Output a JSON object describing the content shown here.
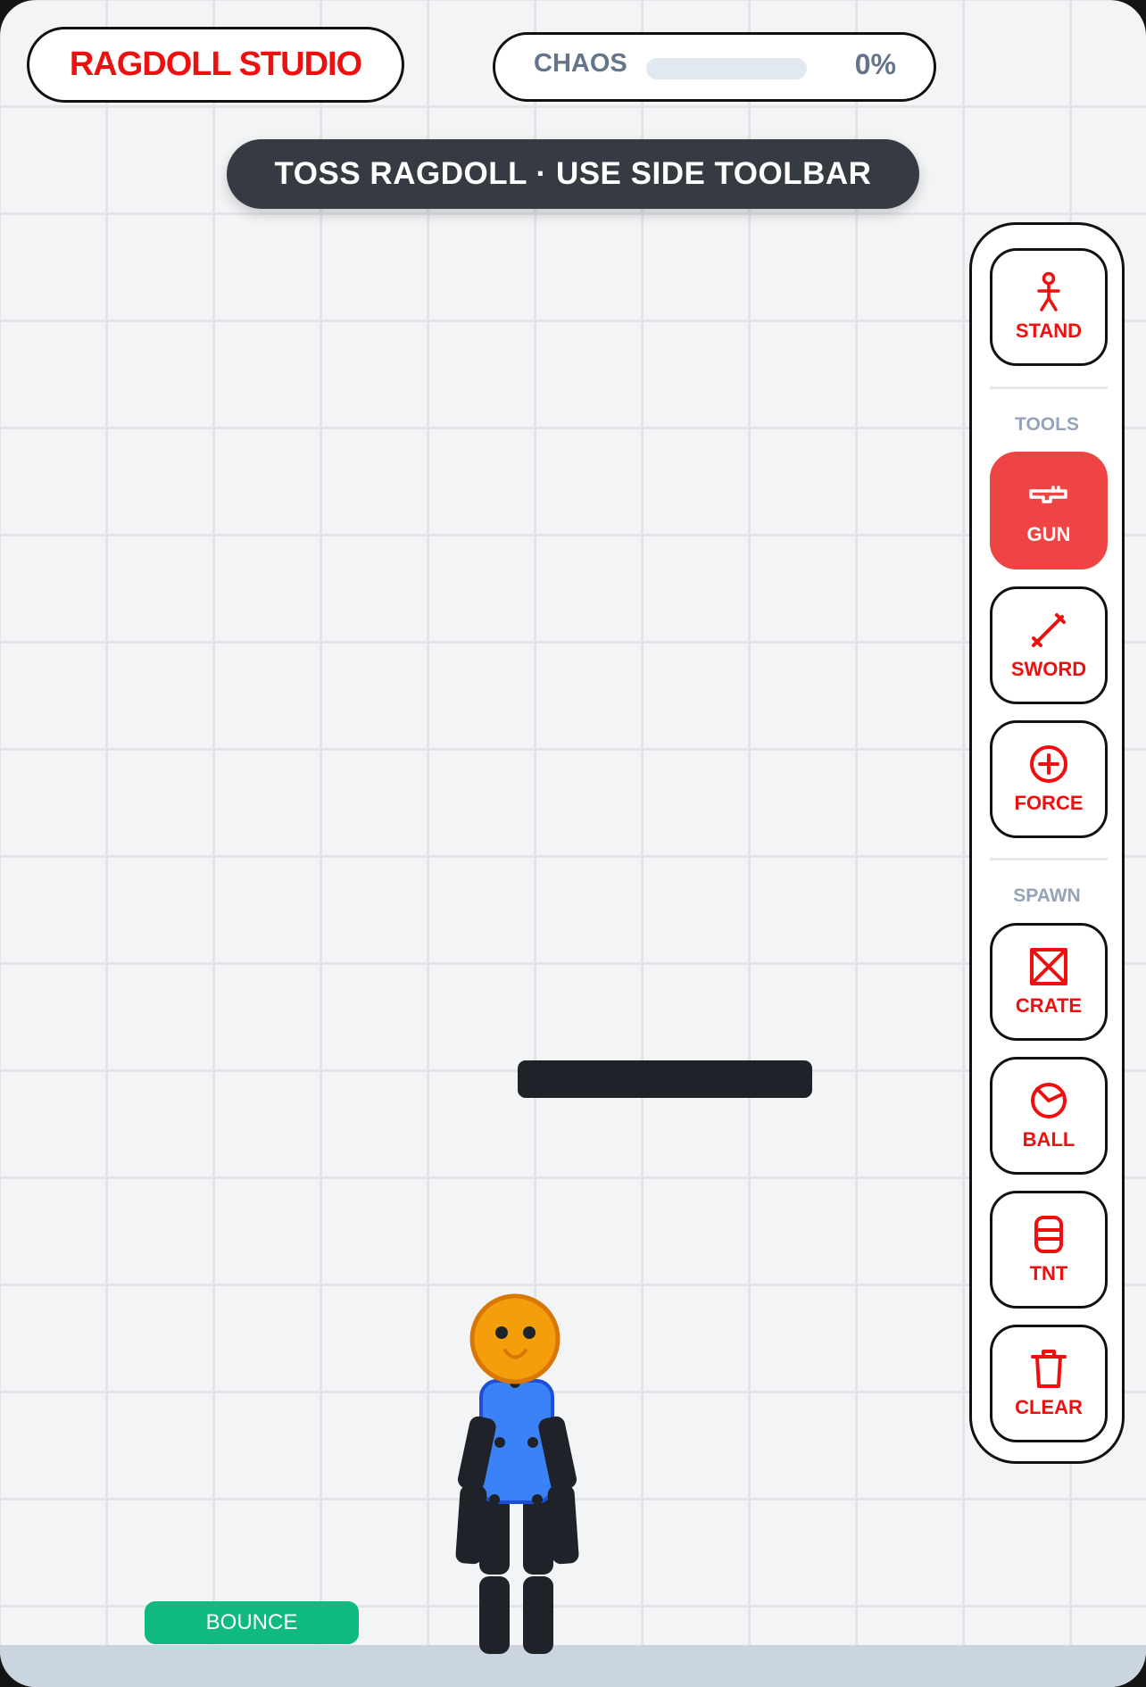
{
  "app": {
    "title": "RAGDOLL STUDIO"
  },
  "chaos": {
    "label": "CHAOS",
    "value": "0%",
    "level": 0
  },
  "hint": {
    "text": "TOSS RAGDOLL · USE SIDE TOOLBAR"
  },
  "toolbar": {
    "stand": {
      "label": "STAND",
      "icon": "stickman-icon"
    },
    "tools_label": "TOOLS",
    "tools": [
      {
        "id": "gun",
        "label": "GUN",
        "icon": "gun-icon",
        "active": true
      },
      {
        "id": "sword",
        "label": "SWORD",
        "icon": "sword-icon",
        "active": false
      },
      {
        "id": "force",
        "label": "FORCE",
        "icon": "plus-circle-icon",
        "active": false
      }
    ],
    "spawn_label": "SPAWN",
    "spawn": [
      {
        "id": "crate",
        "label": "CRATE",
        "icon": "crate-icon"
      },
      {
        "id": "ball",
        "label": "BALL",
        "icon": "ball-icon"
      },
      {
        "id": "tnt",
        "label": "TNT",
        "icon": "tnt-barrel-icon"
      },
      {
        "id": "clear",
        "label": "CLEAR",
        "icon": "trash-icon"
      }
    ]
  },
  "bounce_pad": {
    "label": "BOUNCE"
  },
  "colors": {
    "accent": "#ee0f0f",
    "active_button": "#ef4444",
    "ragdoll_head": "#f59e0b",
    "ragdoll_torso": "#3b82f6",
    "ragdoll_limbs": "#1f2329",
    "bounce_pad": "#10b981",
    "ground": "#cbd5e1"
  }
}
